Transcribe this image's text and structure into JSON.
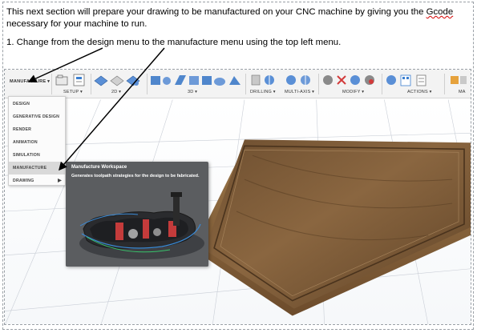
{
  "document": {
    "intro_before": "This next section will prepare your drawing to be manufactured on your CNC machine by giving you the ",
    "intro_gcode": "Gcode",
    "intro_after": " necessary for your machine to run.",
    "step1": "1. Change from the design menu to the manufacture menu using the top left menu."
  },
  "toolbar": {
    "workspace_label": "MANUFACTURE ▾",
    "groups": [
      {
        "label": "SETUP ▾"
      },
      {
        "label": "2D ▾"
      },
      {
        "label": "3D ▾"
      },
      {
        "label": "DRILLING ▾"
      },
      {
        "label": "MULTI-AXIS ▾"
      },
      {
        "label": "MODIFY ▾"
      },
      {
        "label": "ACTIONS ▾"
      },
      {
        "label": "MA"
      }
    ]
  },
  "workspace_menu": {
    "items": [
      {
        "label": "DESIGN"
      },
      {
        "label": "GENERATIVE DESIGN"
      },
      {
        "label": "RENDER"
      },
      {
        "label": "ANIMATION"
      },
      {
        "label": "SIMULATION"
      },
      {
        "label": "MANUFACTURE"
      },
      {
        "label": "DRAWING"
      }
    ],
    "active": "MANUFACTURE"
  },
  "tooltip": {
    "title": "Manufacture Workspace",
    "description": "Generates toolpath strategies for the design to be fabricated."
  },
  "colors": {
    "accent": "#d8d8d8",
    "tooltip_bg": "#5b5d60",
    "wood": "#7d5c3a",
    "arrow": "#000000"
  },
  "icons": [
    "chevron-down-icon",
    "setup-icon",
    "2d-pocket-icon",
    "3d-adaptive-icon",
    "drill-icon",
    "multi-axis-icon",
    "modify-icon",
    "actions-icon",
    "submenu-arrow-icon"
  ]
}
